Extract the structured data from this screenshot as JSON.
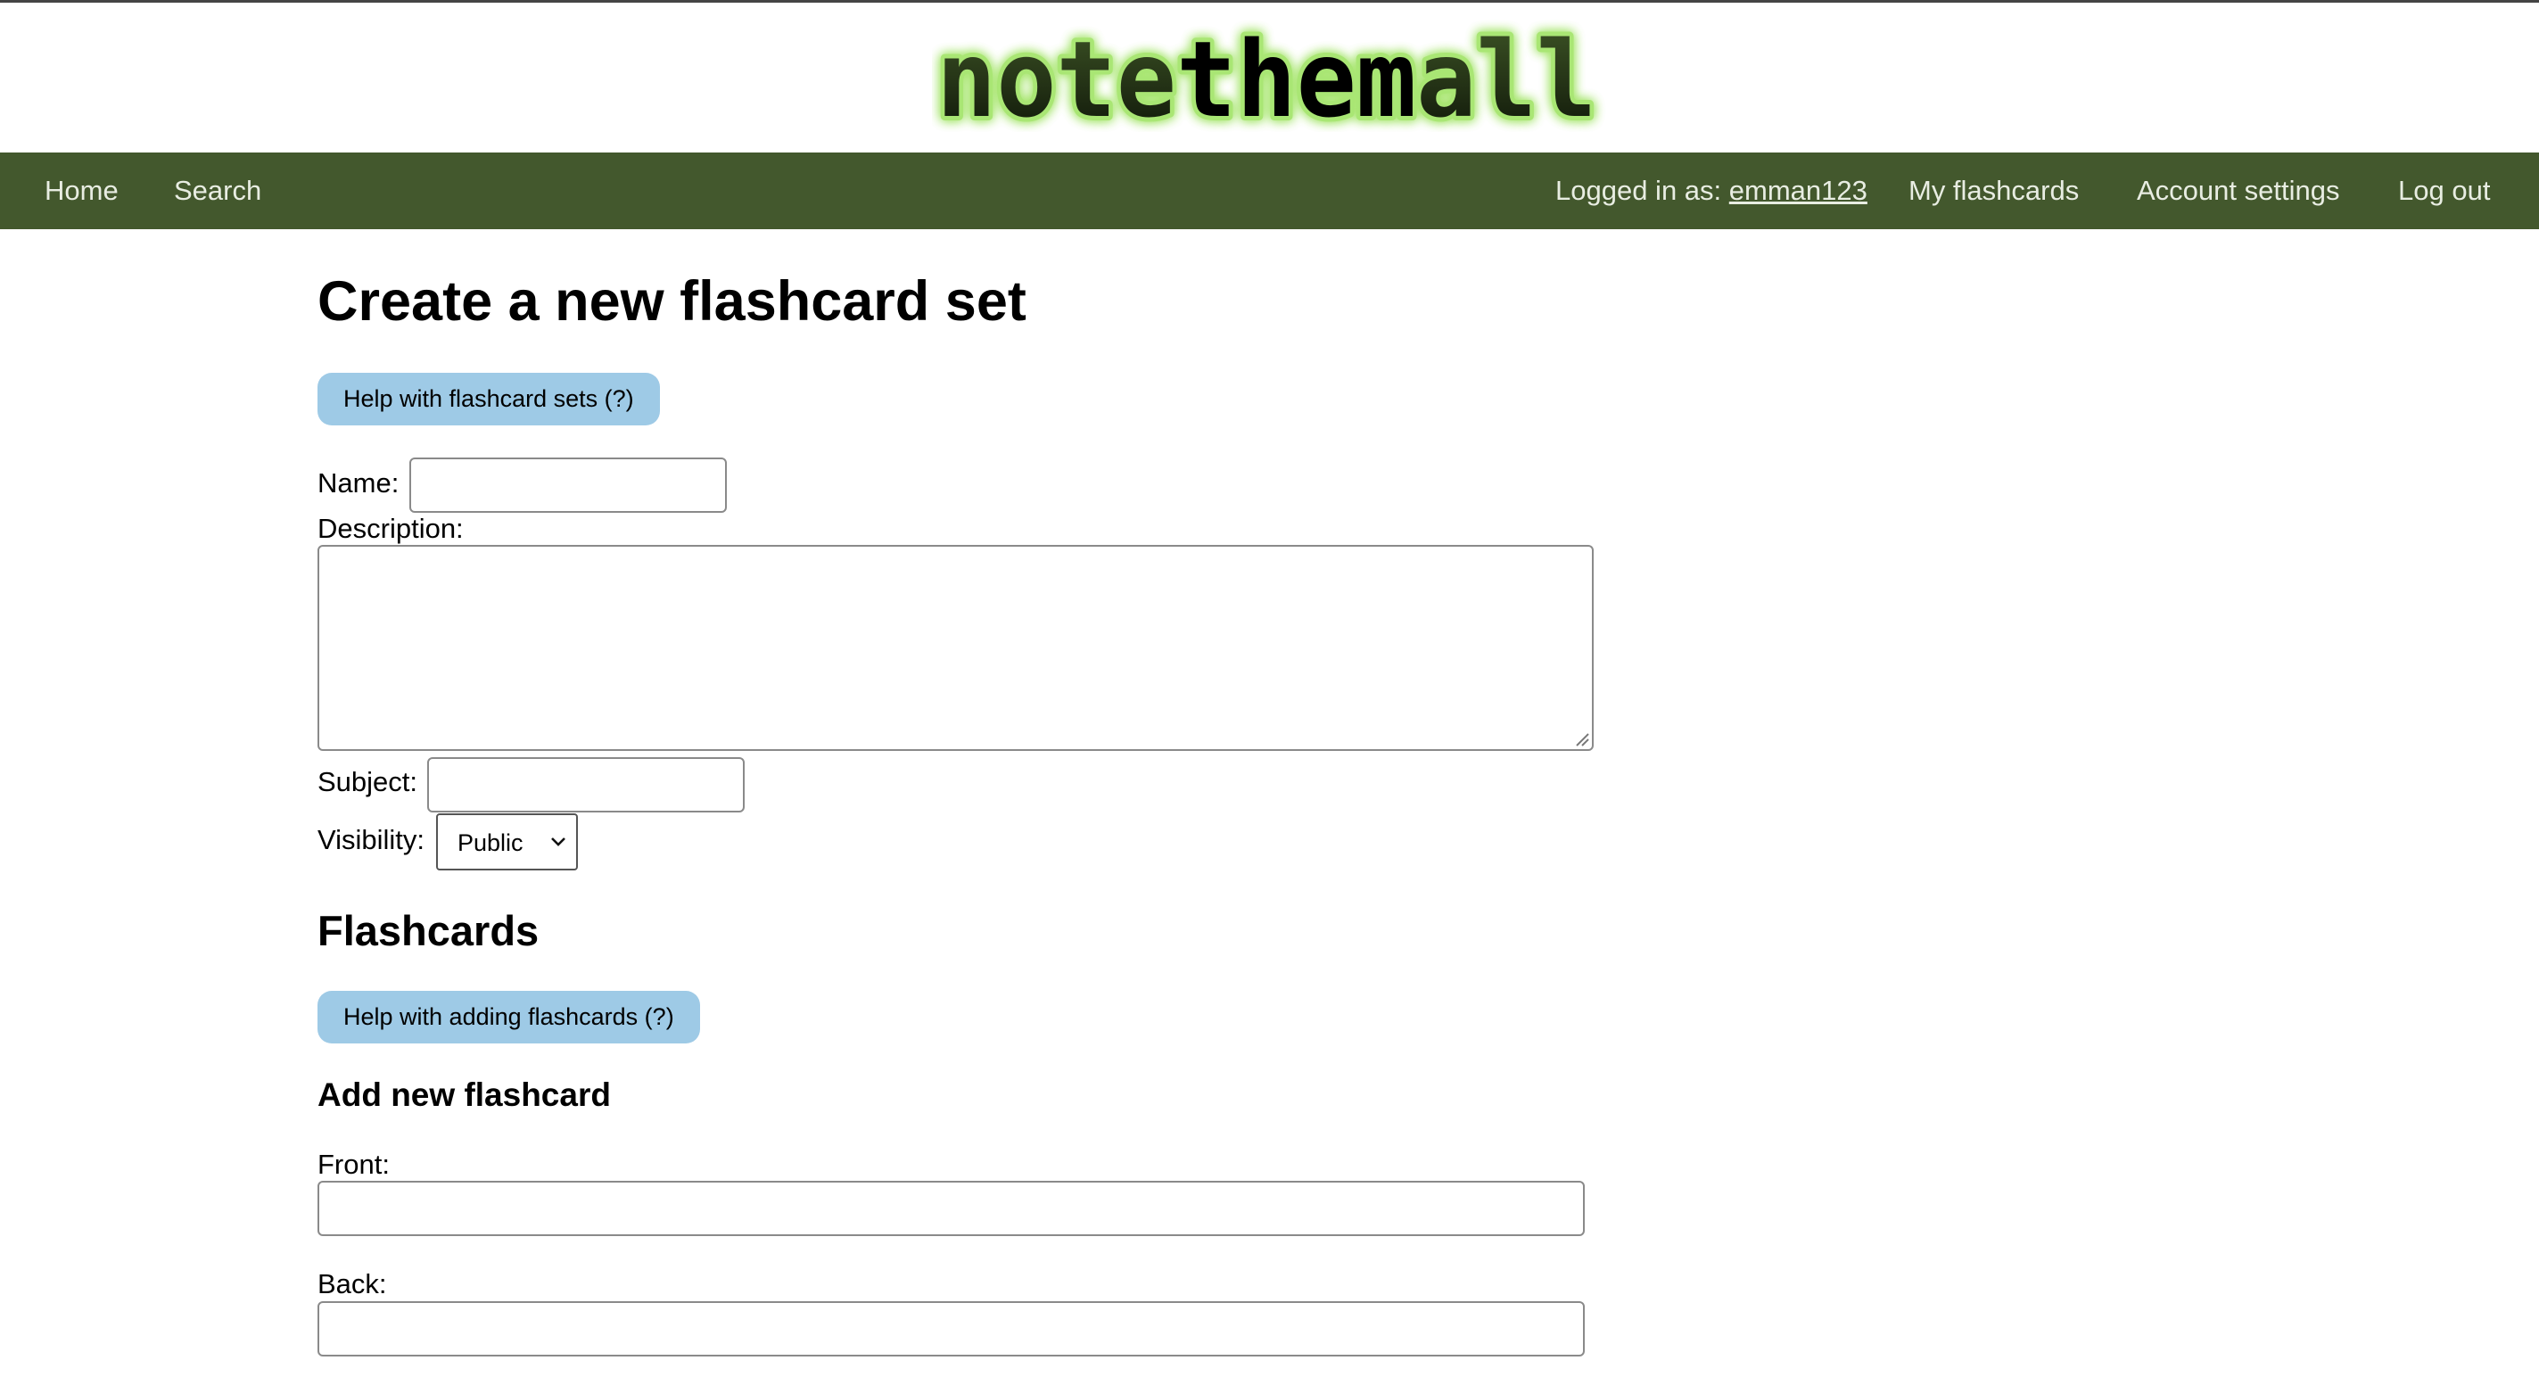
{
  "logo": {
    "text": "notethemall",
    "part1": "note",
    "part2": "them",
    "part3": "all"
  },
  "nav": {
    "home": "Home",
    "search": "Search",
    "logged_in_prefix": "Logged in as:",
    "username": "emman123",
    "my_flashcards": "My flashcards",
    "account_settings": "Account settings",
    "log_out": "Log out"
  },
  "page": {
    "title": "Create a new flashcard set",
    "help_sets": "Help with flashcard sets (?)",
    "name_label": "Name:",
    "name_value": "",
    "description_label": "Description:",
    "description_value": "",
    "subject_label": "Subject:",
    "subject_value": "",
    "visibility_label": "Visibility:",
    "visibility_value": "Public",
    "flashcards_heading": "Flashcards",
    "help_cards": "Help with adding flashcards (?)",
    "add_heading": "Add new flashcard",
    "front_label": "Front:",
    "front_value": "",
    "back_label": "Back:",
    "back_value": ""
  },
  "colors": {
    "nav_bg": "#43582d",
    "help_button_bg": "#9ecae6",
    "logo_glow": "#9be25c"
  },
  "icons": {
    "select_arrow": "chevron-down-icon",
    "resize": "resize-grip-icon"
  }
}
